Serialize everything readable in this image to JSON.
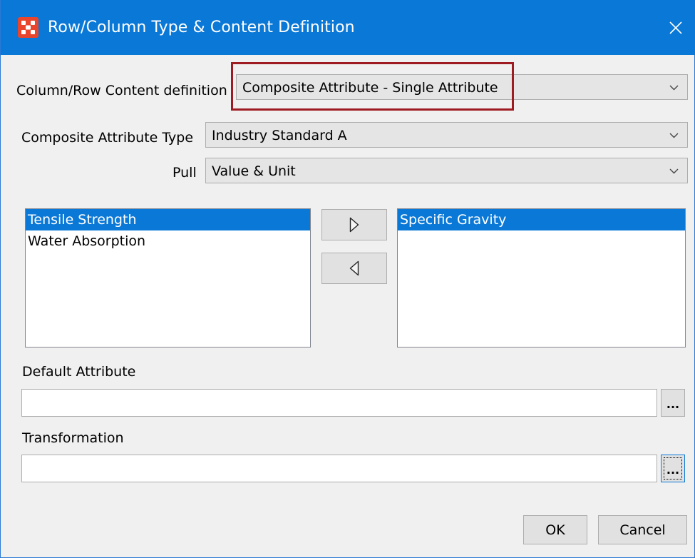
{
  "window": {
    "title": "Row/Column Type & Content Definition",
    "icon": "app-grid-icon",
    "accent_color": "#0a78d7",
    "highlight_color": "#9e1b22"
  },
  "content_definition": {
    "label": "Column/Row Content definition",
    "value": "Composite Attribute - Single Attribute"
  },
  "composite_type": {
    "label": "Composite Attribute Type",
    "value": "Industry Standard A"
  },
  "pull": {
    "label": "Pull",
    "value": "Value & Unit"
  },
  "available_list": {
    "items": [
      "Tensile Strength",
      "Water Absorption"
    ],
    "selected": "Tensile Strength"
  },
  "selected_list": {
    "items": [
      "Specific Gravity"
    ],
    "selected": "Specific Gravity"
  },
  "move_buttons": {
    "add_icon": "triangle-right-icon",
    "remove_icon": "triangle-left-icon"
  },
  "default_attribute": {
    "label": "Default Attribute",
    "value": "",
    "browse_label": "..."
  },
  "transformation": {
    "label": "Transformation",
    "value": "",
    "browse_label": "..."
  },
  "buttons": {
    "ok": "OK",
    "cancel": "Cancel"
  }
}
